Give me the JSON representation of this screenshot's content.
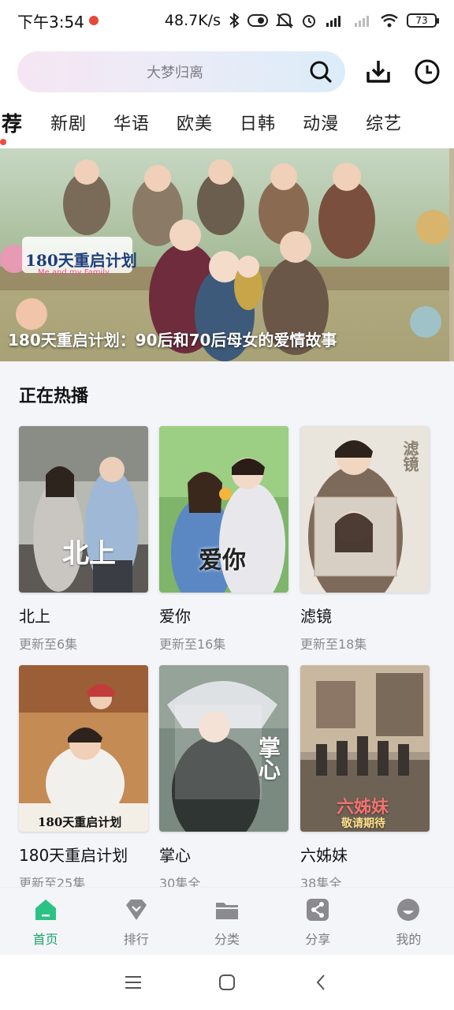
{
  "status_bar": {
    "time": "下午3:54",
    "net_speed": "48.7K/s",
    "battery": "73"
  },
  "search": {
    "placeholder": "大梦归离"
  },
  "tabs": [
    "荐",
    "新剧",
    "华语",
    "欧美",
    "日韩",
    "动漫",
    "综艺"
  ],
  "banner": {
    "caption": "180天重启计划：90后和70后母女的爱情故事",
    "logo_text": "180天重启计划",
    "logo_sub": "Me and my Family"
  },
  "section": {
    "title": "正在热播"
  },
  "cards": [
    {
      "title": "北上",
      "sub": "更新至6集",
      "poster_text": "北上"
    },
    {
      "title": "爱你",
      "sub": "更新至16集",
      "poster_text": "爱你"
    },
    {
      "title": "滤镜",
      "sub": "更新至18集",
      "poster_text": "滤镜"
    },
    {
      "title": "180天重启计划",
      "sub": "更新至25集",
      "poster_text": "180天重启计划"
    },
    {
      "title": "掌心",
      "sub": "30集全",
      "poster_text": "掌心"
    },
    {
      "title": "六姊妹",
      "sub": "38集全",
      "poster_text": "六姊妹",
      "poster_sub": "敬请期待"
    }
  ],
  "bottom_nav": [
    {
      "label": "首页",
      "icon": "home-icon",
      "active": true
    },
    {
      "label": "排行",
      "icon": "ranking-icon",
      "active": false
    },
    {
      "label": "分类",
      "icon": "folder-icon",
      "active": false
    },
    {
      "label": "分享",
      "icon": "share-icon",
      "active": false
    },
    {
      "label": "我的",
      "icon": "profile-icon",
      "active": false
    }
  ],
  "colors": {
    "accent": "#1aa36a",
    "tab_indicator": "#ef4b3f"
  }
}
